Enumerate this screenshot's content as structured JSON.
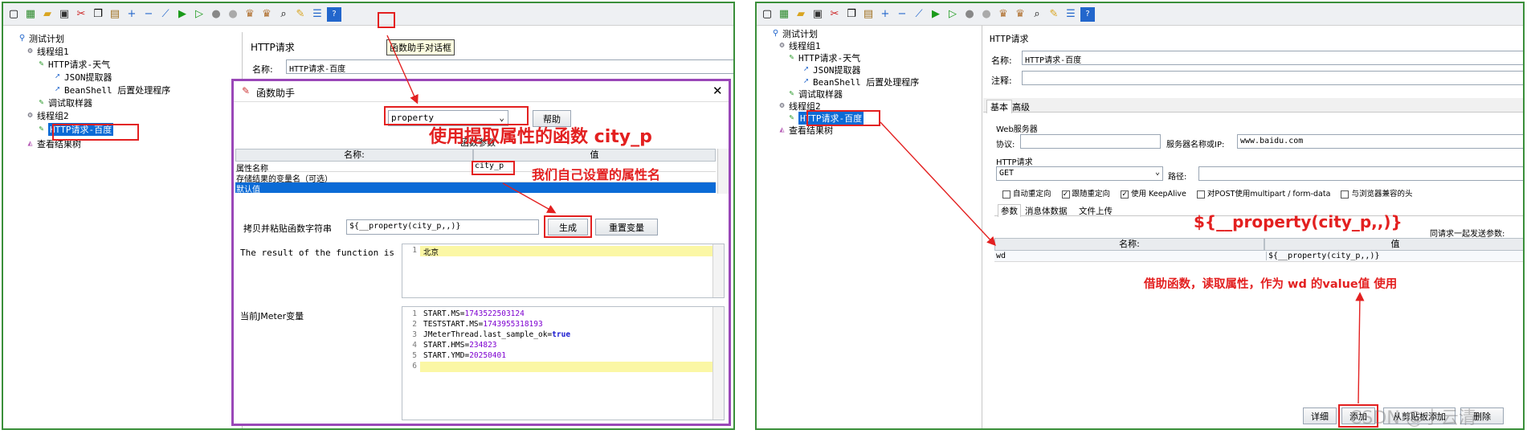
{
  "left": {
    "tree": [
      "测试计划",
      "线程组1",
      "HTTP请求-天气",
      "JSON提取器",
      "BeanShell 后置处理程序",
      "调试取样器",
      "线程组2",
      "HTTP请求-百度",
      "查看结果树"
    ],
    "tooltip": "函数助手对话框",
    "bg_header": "HTTP请求",
    "bg_name_label": "名称:",
    "bg_name_value": "HTTP请求-百度",
    "dialog": {
      "title": "函数助手",
      "function_select": "property",
      "help_button": "帮助",
      "params_title": "函数参数",
      "col_name": "名称:",
      "col_value": "值",
      "rows": [
        {
          "name": "属性名称",
          "value": "city_p"
        },
        {
          "name": "存储结果的变量名（可选）",
          "value": ""
        },
        {
          "name": "默认值",
          "value": ""
        }
      ],
      "copy_label": "拷贝并粘贴函数字符串",
      "function_string": "${__property(city_p,,)}",
      "generate_button": "生成",
      "reset_button": "重置变量",
      "result_label": "The result of the function is",
      "result_lines": [
        {
          "n": "1",
          "t": "北京"
        }
      ],
      "vars_label": "当前JMeter变量",
      "vars_lines": [
        {
          "n": "1",
          "k": "START.MS=",
          "v": "1743522503124"
        },
        {
          "n": "2",
          "k": "TESTSTART.MS=",
          "v": "1743955318193"
        },
        {
          "n": "3",
          "k": "JMeterThread.last_sample_ok=",
          "v": "true"
        },
        {
          "n": "4",
          "k": "START.HMS=",
          "v": "234823"
        },
        {
          "n": "5",
          "k": "START.YMD=",
          "v": "20250401"
        },
        {
          "n": "6",
          "k": "",
          "v": ""
        }
      ]
    },
    "annotation_title": "使用提取属性的函数 city_p",
    "annotation_attr": "我们自己设置的属性名"
  },
  "right": {
    "tree": [
      "测试计划",
      "线程组1",
      "HTTP请求-天气",
      "JSON提取器",
      "BeanShell 后置处理程序",
      "调试取样器",
      "线程组2",
      "HTTP请求-百度",
      "查看结果树"
    ],
    "header": "HTTP请求",
    "name_label": "名称:",
    "name_value": "HTTP请求-百度",
    "comment_label": "注释:",
    "tabs": [
      "基本",
      "高级"
    ],
    "web_server": "Web服务器",
    "protocol_label": "协议:",
    "server_label": "服务器名称或IP:",
    "server_value": "www.baidu.com",
    "http_request": "HTTP请求",
    "method": "GET",
    "path_label": "路径:",
    "checkboxes": [
      {
        "label": "自动重定向",
        "checked": false
      },
      {
        "label": "跟随重定向",
        "checked": true
      },
      {
        "label": "使用 KeepAlive",
        "checked": true
      },
      {
        "label": "对POST使用multipart / form-data",
        "checked": false
      },
      {
        "label": "与浏览器兼容的头",
        "checked": false
      }
    ],
    "subtabs": [
      "参数",
      "消息体数据",
      "文件上传"
    ],
    "send_params": "同请求一起发送参数:",
    "col_name": "名称:",
    "col_value": "值",
    "param_row": {
      "name": "wd",
      "value": "${__property(city_p,,)}"
    },
    "annotation_expr": "${__property(city_p,,)}",
    "annotation_desc": "借助函数，读取属性，作为 wd 的value值 使用",
    "bottom_buttons": [
      "详细",
      "添加",
      "从剪贴板添加",
      "删除"
    ],
    "watermark": "CSDN @小云清"
  }
}
